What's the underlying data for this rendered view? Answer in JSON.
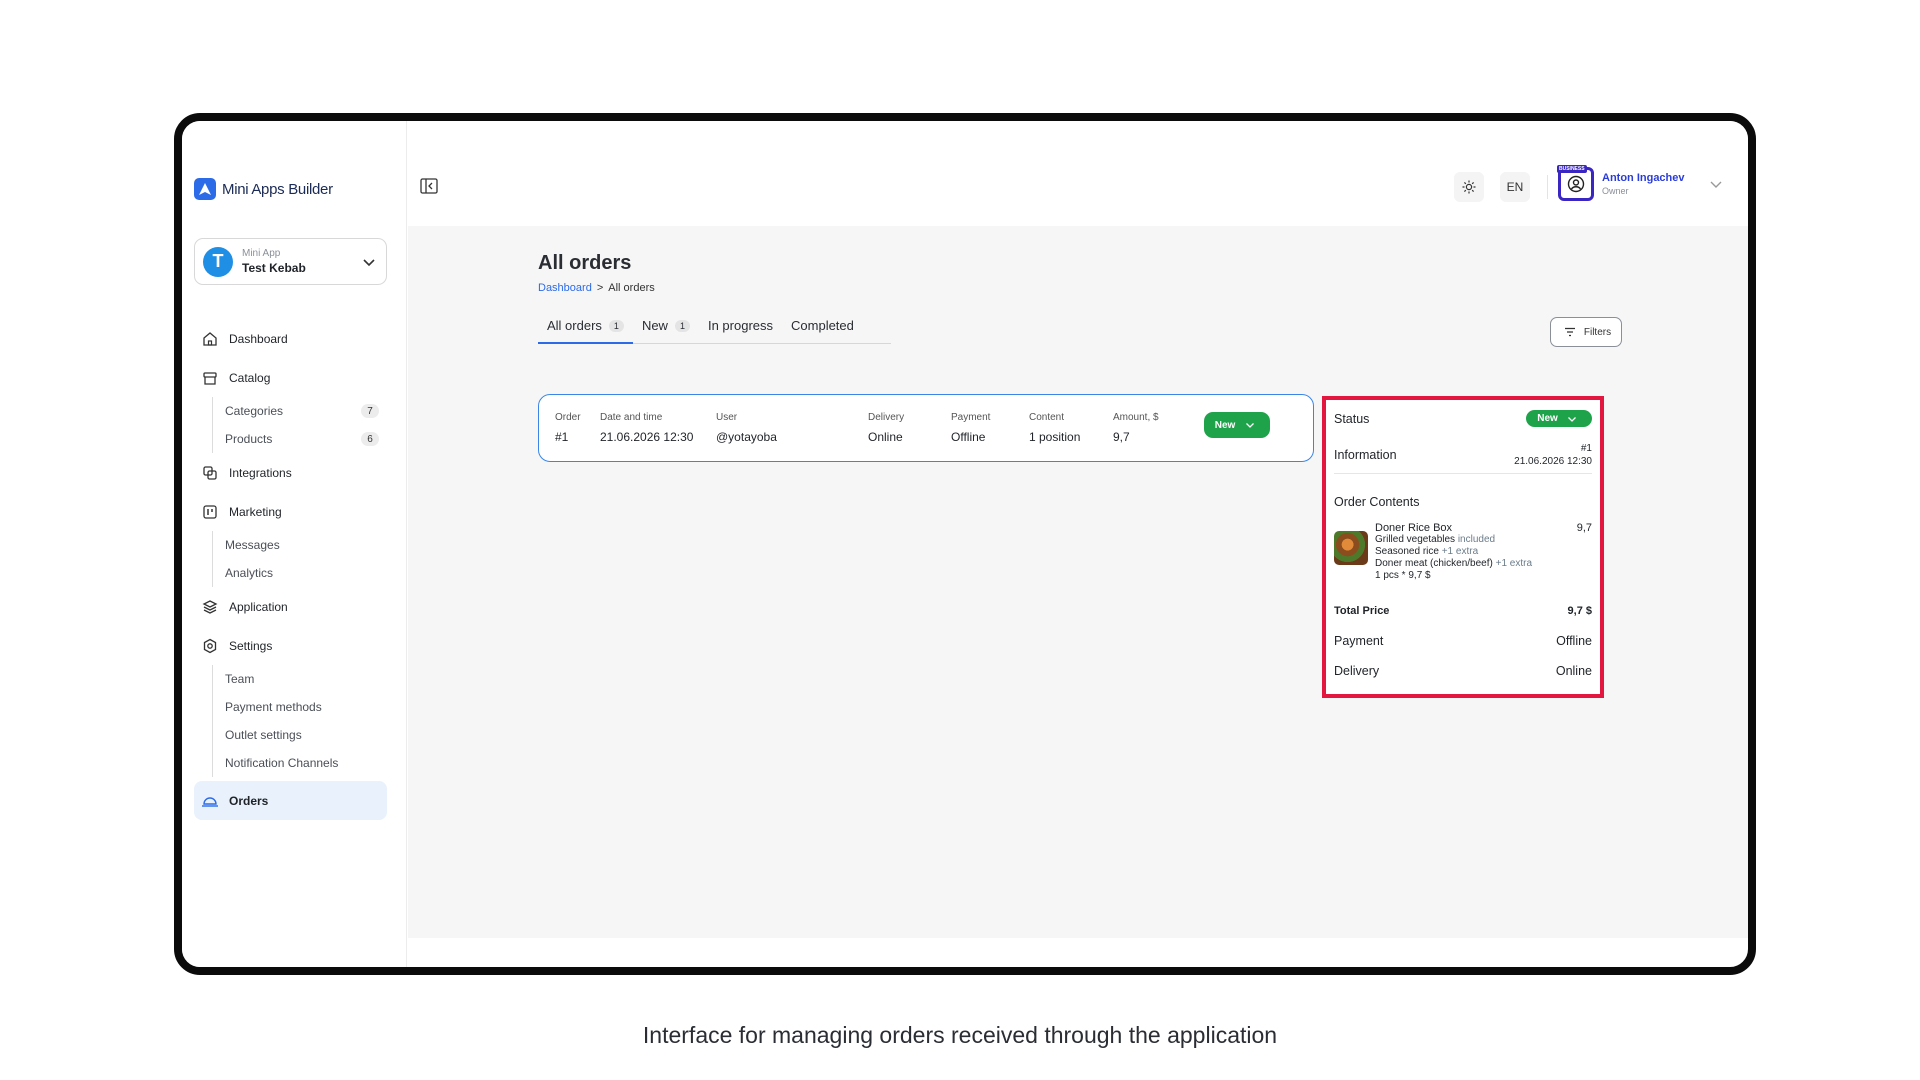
{
  "app": {
    "logo_text": "Mini Apps Builder",
    "selector_label": "Mini App",
    "selector_name": "Test Kebab",
    "avatar_letter": "T"
  },
  "sidebar": {
    "dashboard": "Dashboard",
    "catalog": "Catalog",
    "categories": "Categories",
    "categories_count": "7",
    "products": "Products",
    "products_count": "6",
    "integrations": "Integrations",
    "marketing": "Marketing",
    "messages": "Messages",
    "analytics": "Analytics",
    "application": "Application",
    "settings": "Settings",
    "team": "Team",
    "payment_methods": "Payment methods",
    "outlet_settings": "Outlet settings",
    "notification_channels": "Notification Channels",
    "orders": "Orders"
  },
  "topbar": {
    "language": "EN",
    "user_name": "Anton Ingachev",
    "user_role": "Owner",
    "badge": "BUSINESS"
  },
  "page": {
    "title": "All orders",
    "crumb_home": "Dashboard",
    "crumb_sep": ">",
    "crumb_current": "All orders",
    "filters": "Filters"
  },
  "tabs": [
    {
      "label": "All orders",
      "count": "1"
    },
    {
      "label": "New",
      "count": "1"
    },
    {
      "label": "In progress"
    },
    {
      "label": "Completed"
    }
  ],
  "order": {
    "order_label": "Order",
    "order_value": "#1",
    "date_label": "Date and time",
    "date_value": "21.06.2026 12:30",
    "user_label": "User",
    "user_value": "@yotayoba",
    "delivery_label": "Delivery",
    "delivery_value": "Online",
    "payment_label": "Payment",
    "payment_value": "Offline",
    "content_label": "Content",
    "content_value": "1 position",
    "amount_label": "Amount, $",
    "amount_value": "9,7",
    "status": "New"
  },
  "detail": {
    "status_label": "Status",
    "status_value": "New",
    "info_label": "Information",
    "info_number": "#1",
    "info_date": "21.06.2026 12:30",
    "contents_label": "Order Contents",
    "item_name": "Doner Rice Box",
    "item_price": "9,7",
    "mod1": "Grilled vegetables",
    "mod1_note": "included",
    "mod2": "Seasoned rice",
    "mod2_note": "+1 extra",
    "mod3": "Doner meat (chicken/beef)",
    "mod3_note": "+1 extra",
    "qty_line": "1 pcs * 9,7 $",
    "total_label": "Total Price",
    "total_value": "9,7 $",
    "payment_label": "Payment",
    "payment_value": "Offline",
    "delivery_label": "Delivery",
    "delivery_value": "Online"
  },
  "caption": "Interface for managing orders received through the application",
  "colors": {
    "accent": "#2b6be8",
    "status_green": "#1fa34a",
    "highlight_red": "#e2163e",
    "nav_active_bg": "#e8f1fc"
  }
}
